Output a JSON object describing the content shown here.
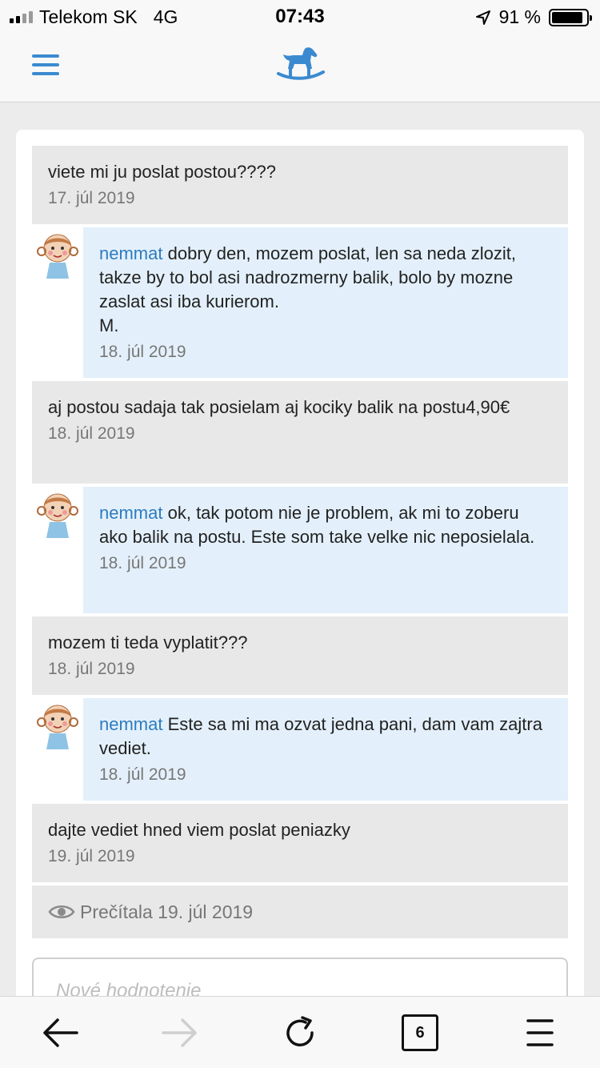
{
  "status_bar": {
    "carrier": "Telekom SK",
    "network": "4G",
    "time": "07:43",
    "battery_text": "91 %",
    "battery_level": 0.91
  },
  "colors": {
    "accent": "#3b8ad0",
    "author": "#2d7cc0",
    "other_bubble": "#e8e8e8",
    "mine_bubble": "#e3f0fb"
  },
  "messages": [
    {
      "type": "other",
      "text": "viete mi ju poslat postou????",
      "date": "17. júl 2019"
    },
    {
      "type": "mine",
      "author": "nemmat",
      "text": "dobry den, mozem poslat, len sa neda zlozit, takze by to bol asi nadrozmerny balik, bolo by mozne zaslat asi iba kurierom.",
      "signature": "M.",
      "date": "18. júl 2019"
    },
    {
      "type": "other",
      "text": "aj postou sadaja tak posielam aj kociky balik na postu4,90€",
      "date": "18. júl 2019"
    },
    {
      "type": "mine",
      "author": "nemmat",
      "text": "ok, tak potom nie je problem, ak mi to zoberu ako balik na postu. Este som take velke nic neposielala.",
      "date": "18. júl 2019"
    },
    {
      "type": "other",
      "text": "mozem ti teda vyplatit???",
      "date": "18. júl 2019"
    },
    {
      "type": "mine",
      "author": "nemmat",
      "text": "Este sa mi ma ozvat jedna pani, dam vam zajtra vediet.",
      "date": "18. júl 2019"
    },
    {
      "type": "other",
      "text": "dajte vediet hned viem poslat peniazky",
      "date": "19. júl 2019"
    }
  ],
  "read_status": "Prečítala 19. júl 2019",
  "review": {
    "placeholder": "Nové hodnotenie"
  },
  "browser": {
    "tab_count": "6"
  }
}
